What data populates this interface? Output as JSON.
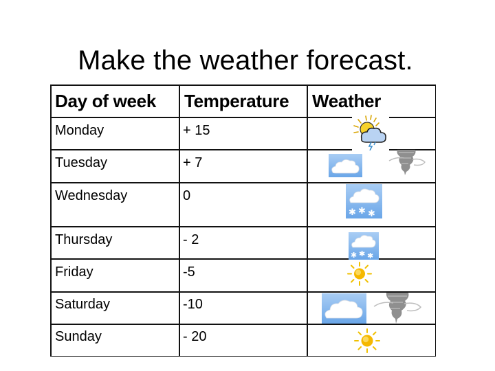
{
  "slide": {
    "title": "Make the weather forecast."
  },
  "table": {
    "headers": [
      "Day of week",
      "Temperature",
      "Weather"
    ],
    "rows": [
      {
        "day": "Monday",
        "temperature": "+ 15",
        "weather_icons": [
          "sun-cloud-lightning-icon"
        ]
      },
      {
        "day": "Tuesday",
        "temperature": "+ 7",
        "weather_icons": [
          "cloud-icon",
          "tornado-icon"
        ]
      },
      {
        "day": "Wednesday",
        "temperature": "0",
        "weather_icons": [
          "snow-cloud-icon"
        ]
      },
      {
        "day": "Thursday",
        "temperature": "- 2",
        "weather_icons": [
          "snow-cloud-icon"
        ]
      },
      {
        "day": "Friday",
        "temperature": "-5",
        "weather_icons": [
          "sun-icon"
        ]
      },
      {
        "day": "Saturday",
        "temperature": "-10",
        "weather_icons": [
          "cloud-icon",
          "tornado-icon"
        ]
      },
      {
        "day": "Sunday",
        "temperature": "- 20",
        "weather_icons": [
          "sun-icon"
        ]
      }
    ]
  },
  "colors": {
    "border": "#111111",
    "sun": "#f5c518",
    "sky_box": "#7fb3ee",
    "cloud": "#ffffff",
    "tornado": "#8a8a8a"
  }
}
